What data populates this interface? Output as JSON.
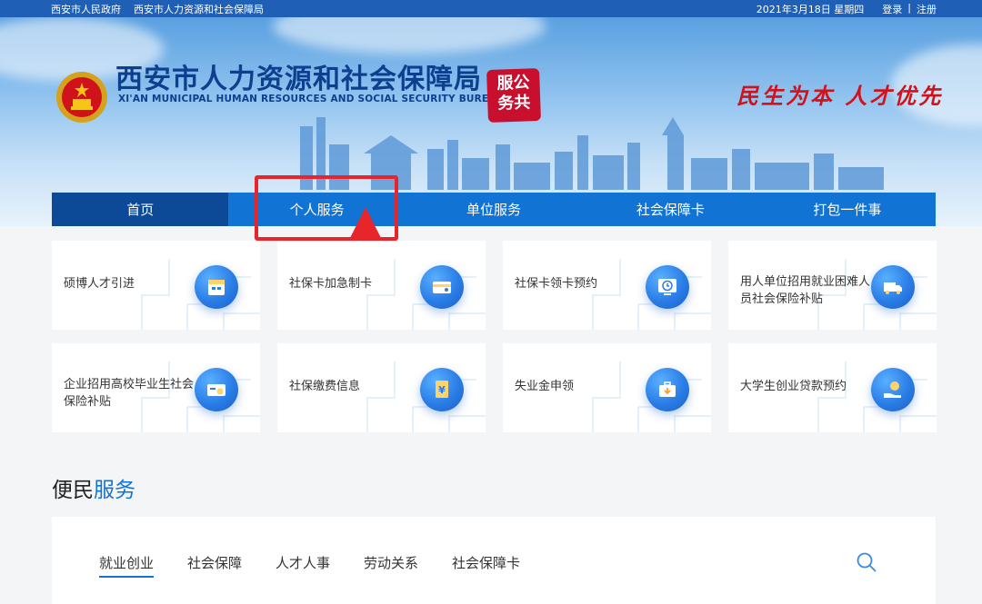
{
  "topbar": {
    "links": [
      "西安市人民政府",
      "西安市人力资源和社会保障局"
    ],
    "date": "2021年3月18日 星期四",
    "login": "登录",
    "separator": "|",
    "register": "注册"
  },
  "header": {
    "title_cn": "西安市人力资源和社会保障局",
    "title_en": "XI'AN MUNICIPAL HUMAN RESOURCES AND SOCIAL SECURITY BUREAU",
    "seal_line1": "服公",
    "seal_line2": "务共",
    "slogan": "民生为本 人才优先"
  },
  "nav": {
    "items": [
      "首页",
      "个人服务",
      "单位服务",
      "社会保障卡",
      "打包一件事"
    ],
    "active_index": 0
  },
  "cards": [
    {
      "label": "硕博人才引进",
      "icon": "calendar-icon"
    },
    {
      "label": "社保卡加急制卡",
      "icon": "card-icon"
    },
    {
      "label": "社保卡领卡预约",
      "icon": "clock-monitor-icon"
    },
    {
      "label": "用人单位招用就业困难人员社会保险补贴",
      "icon": "truck-icon"
    },
    {
      "label": "企业招用高校毕业生社会保险补贴",
      "icon": "coin-card-icon"
    },
    {
      "label": "社保缴费信息",
      "icon": "yuan-document-icon"
    },
    {
      "label": "失业金申领",
      "icon": "briefcase-icon"
    },
    {
      "label": "大学生创业贷款预约",
      "icon": "hand-coin-icon"
    }
  ],
  "convenience": {
    "title_a": "便民",
    "title_b": "服务",
    "tabs": [
      "就业创业",
      "社会保障",
      "人才人事",
      "劳动关系",
      "社会保障卡"
    ],
    "active_tab": 0
  },
  "colors": {
    "brand_blue": "#1173d3",
    "nav_active": "#0c4a98",
    "highlight_red": "#e8252b",
    "seal_red": "#c8102e"
  }
}
